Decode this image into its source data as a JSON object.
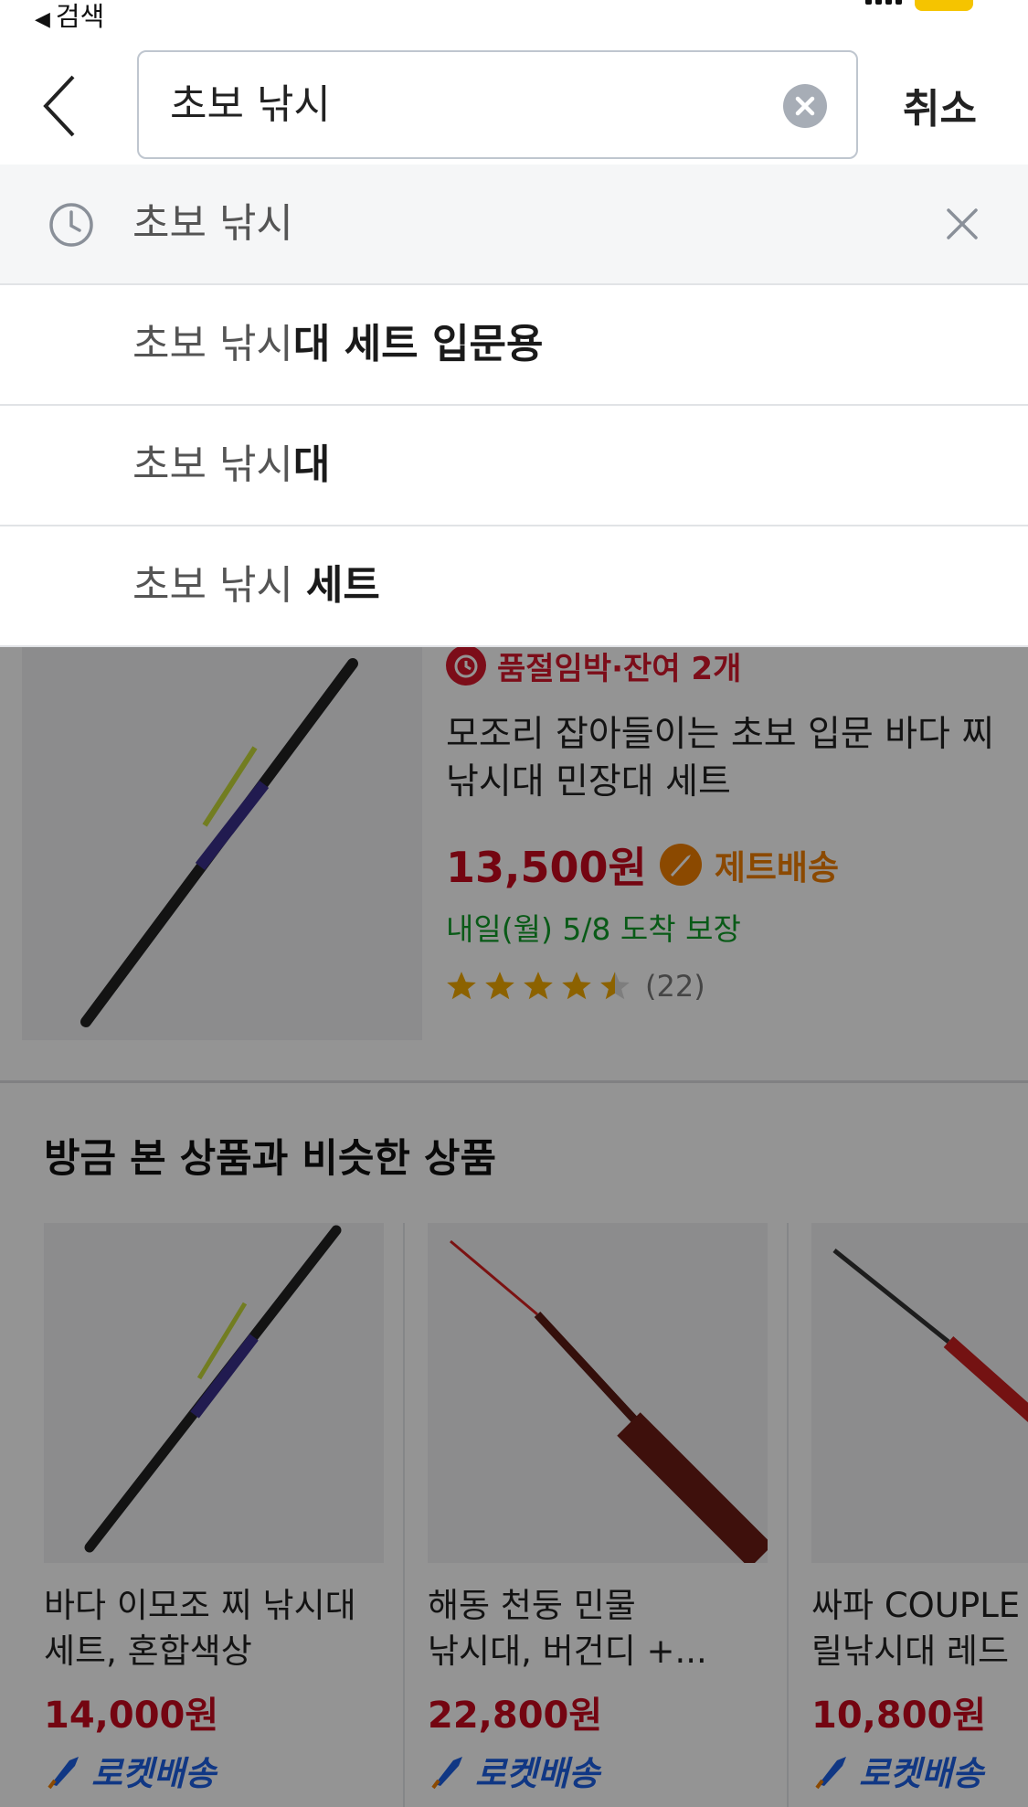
{
  "status_bar": {
    "back_app_label": "검색"
  },
  "search": {
    "query": "초보 낚시",
    "cancel_label": "취소"
  },
  "suggestions": {
    "recent": {
      "text": "초보 낚시"
    },
    "items": [
      {
        "prefix": "초보 낚시",
        "suffix": "대 세트 입문용"
      },
      {
        "prefix": "초보 낚시",
        "suffix": "대"
      },
      {
        "prefix": "초보 낚시 ",
        "suffix": "세트"
      }
    ]
  },
  "product": {
    "stock_badge": "품절임박·잔여 2개",
    "title": "모조리 잡아들이는 초보 입문 바다 찌 낚시대 민장대 세트",
    "price": "13,500원",
    "shipping_label": "제트배송",
    "delivery": "내일(월) 5/8 도착 보장",
    "rating": 4.5,
    "rating_max": 5,
    "review_count": "(22)"
  },
  "similar": {
    "title": "방금 본 상품과 비슷한 상품",
    "cards": [
      {
        "title_line1": "바다 이모조 찌 낚시대",
        "title_line2": "세트, 혼합색상",
        "price": "14,000원",
        "shipping": "로켓배송"
      },
      {
        "title_line1": "해동 천둥 민물",
        "title_line2": "낚시대, 버건디 +...",
        "price": "22,800원",
        "shipping": "로켓배송"
      },
      {
        "title_line1": "싸파 COUPLE",
        "title_line2": "릴낚시대 레드",
        "price": "10,800원",
        "shipping": "로켓배송"
      }
    ]
  },
  "colors": {
    "price_red": "#c80a1e",
    "delivery_green": "#109b28",
    "jet_orange": "#f07e00",
    "rocket_blue": "#1d5fe3",
    "overlay": "rgba(0,0,0,0.42)"
  }
}
